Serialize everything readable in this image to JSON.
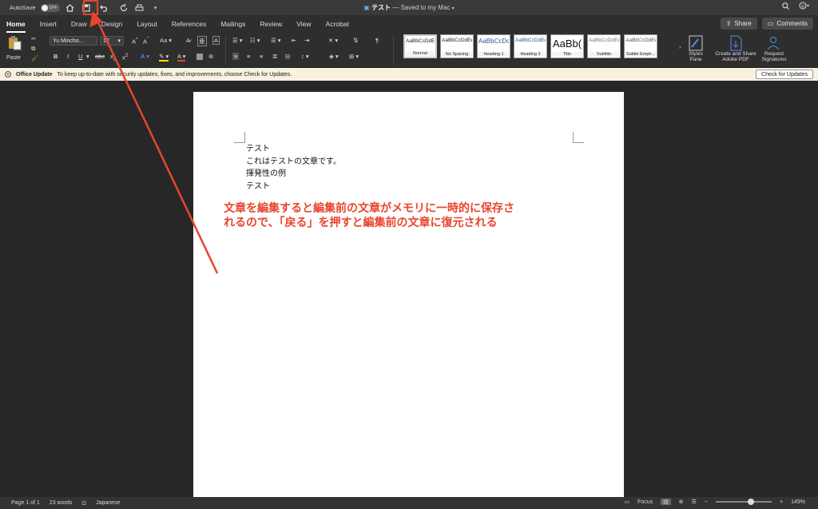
{
  "titlebar": {
    "autosave_label": "AutoSave",
    "autosave_state": "OFF",
    "doc_name": "テスト",
    "doc_status": "— Saved to my Mac"
  },
  "tabs": [
    "Home",
    "Insert",
    "Draw",
    "Design",
    "Layout",
    "References",
    "Mailings",
    "Review",
    "View",
    "Acrobat"
  ],
  "tabs_right": {
    "share": "Share",
    "comments": "Comments"
  },
  "ribbon": {
    "paste": "Paste",
    "font_name": "Yu Mincho...",
    "font_size": "12",
    "grow_shrink": "Aa",
    "styles": [
      {
        "sample": "AaBbCcDdEe",
        "name": "Normal"
      },
      {
        "sample": "AaBbCcDdEe",
        "name": "No Spacing"
      },
      {
        "sample": "AaBbCcDc",
        "name": "Heading 1"
      },
      {
        "sample": "AaBbCcDdEe",
        "name": "Heading 2"
      },
      {
        "sample": "AaBb(",
        "name": "Title"
      },
      {
        "sample": "AaBbCcDdEe",
        "name": "Subtitle"
      },
      {
        "sample": "AaBbCcDdEe",
        "name": "Subtle Emph..."
      }
    ],
    "styles_pane": "Styles Pane",
    "create_pdf": "Create and Share Adobe PDF",
    "request_sig": "Request Signatures"
  },
  "update_bar": {
    "title": "Office Update",
    "message": "To keep up-to-date with security updates, fixes, and improvements, choose Check for Updates.",
    "button": "Check for Updates"
  },
  "document": {
    "lines": [
      "テスト",
      "これはテストの文章です。",
      "揮発性の例",
      "テスト"
    ]
  },
  "annotation": {
    "line1": "文章を編集すると編集前の文章がメモリに一時的に保存さ",
    "line2": "れるので、「戻る」を押すと編集前の文章に復元される"
  },
  "statusbar": {
    "page": "Page 1 of 1",
    "words": "23 words",
    "language": "Japanese",
    "focus": "Focus",
    "zoom": "149%"
  },
  "colors": {
    "accent_red": "#e8452c",
    "update_bg": "#f7f1de"
  }
}
